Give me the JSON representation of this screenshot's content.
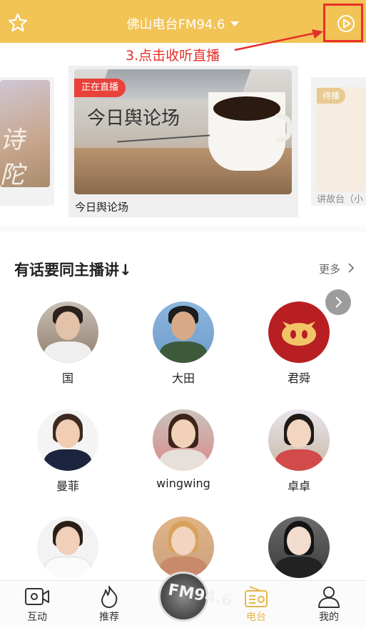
{
  "header": {
    "station_title": "佛山电台FM94.6",
    "icons": {
      "favorite": "star-icon",
      "dropdown": "caret-down-icon",
      "play": "play-circle-icon"
    }
  },
  "annotation": {
    "text": "3.点击收听直播",
    "color": "#e5302a"
  },
  "carousel": {
    "left_card": {
      "art_text": "诗 陀"
    },
    "main_card": {
      "badge": "正在直播",
      "logo_text": "今日舆论场",
      "caption": "今日舆论场"
    },
    "right_card": {
      "badge": "待播",
      "caption": "讲故台（小"
    }
  },
  "section": {
    "title": "有话要同主播讲↓",
    "more_label": "更多",
    "more_icon": "chevron-right-icon"
  },
  "hosts": [
    {
      "name": "国"
    },
    {
      "name": "大田"
    },
    {
      "name": "君舜"
    },
    {
      "name": "曼菲"
    },
    {
      "name": "wingwing"
    },
    {
      "name": "卓卓"
    },
    {
      "name": ""
    },
    {
      "name": ""
    },
    {
      "name": ""
    }
  ],
  "tabbar": {
    "items": [
      {
        "label": "互动",
        "icon": "video-camera-icon"
      },
      {
        "label": "推荐",
        "icon": "flame-icon"
      },
      {
        "label": "电台",
        "icon": "radio-icon",
        "active": true
      },
      {
        "label": "我的",
        "icon": "user-icon"
      }
    ],
    "center_logo_text": "FM94.6"
  },
  "colors": {
    "header_bg": "#f2c355",
    "accent": "#e8b64a",
    "live_badge": "#e8423a",
    "annotation": "#e5302a"
  }
}
